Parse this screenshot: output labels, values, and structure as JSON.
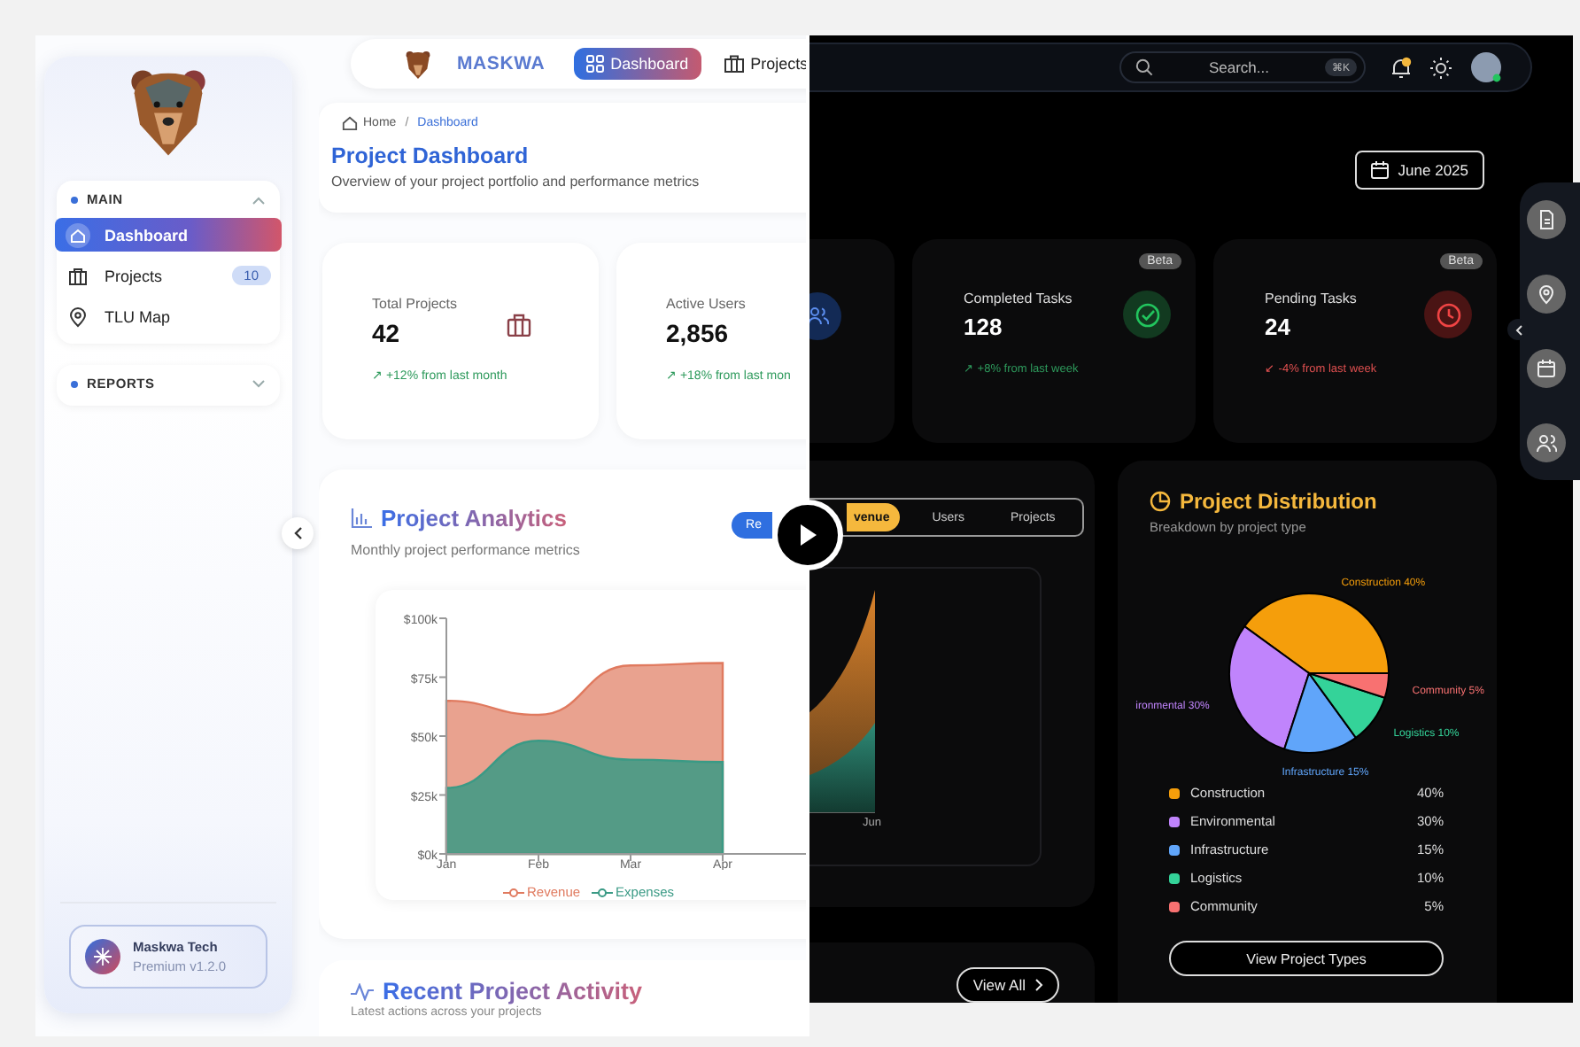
{
  "light": {
    "sidebar": {
      "sections": [
        {
          "title": "MAIN",
          "expanded": true,
          "items": [
            {
              "label": "Dashboard",
              "selected": true
            },
            {
              "label": "Projects",
              "selected": false,
              "badge": "10"
            },
            {
              "label": "TLU Map",
              "selected": false
            }
          ]
        },
        {
          "title": "REPORTS",
          "expanded": false
        }
      ],
      "footer": {
        "name": "Maskwa Tech",
        "plan": "Premium v1.2.0"
      }
    },
    "top_nav": {
      "brand": "MASKWA",
      "tabs": [
        {
          "label": "Dashboard",
          "selected": true
        },
        {
          "label": "Projects",
          "selected": false
        }
      ]
    },
    "breadcrumb": {
      "items": [
        "Home",
        "Dashboard"
      ],
      "separator": "/"
    },
    "header": {
      "title": "Project Dashboard",
      "subtitle": "Overview of your project portfolio and performance metrics"
    },
    "stats": [
      {
        "label": "Total Projects",
        "value": "42",
        "change": "↗ +12% from last month",
        "positive": true
      },
      {
        "label": "Active Users",
        "value": "2,856",
        "change": "↗ +18% from last mon",
        "positive": true
      }
    ],
    "analytics": {
      "title": "Project Analytics",
      "subtitle": "Monthly project performance metrics",
      "toggle_label": "Re",
      "chart_data": {
        "type": "area",
        "categories": [
          "Jan",
          "Feb",
          "Mar",
          "Apr"
        ],
        "series": [
          {
            "name": "Revenue",
            "color": "#e07a5f",
            "values": [
              65,
              59,
              80,
              81
            ]
          },
          {
            "name": "Expenses",
            "color": "#3a9a85",
            "values": [
              28,
              48,
              40,
              39
            ]
          }
        ],
        "stacked": false,
        "ylim": [
          0,
          100
        ],
        "yticks": [
          {
            "value": 0,
            "label": "$0k"
          },
          {
            "value": 25,
            "label": "$25k"
          },
          {
            "value": 50,
            "label": "$50k"
          },
          {
            "value": 75,
            "label": "$75k"
          },
          {
            "value": 100,
            "label": "$100k"
          }
        ]
      }
    },
    "activity": {
      "title": "Recent Project Activity",
      "subtitle": "Latest actions across your projects"
    }
  },
  "dark": {
    "search": {
      "placeholder": "Search...",
      "shortcut": "⌘K"
    },
    "date_button": "June 2025",
    "stats": [
      {
        "label": "Completed Tasks",
        "value": "128",
        "change": "↗ +8% from last week",
        "positive": true,
        "badge": "Beta"
      },
      {
        "label": "Pending Tasks",
        "value": "24",
        "change": "↙ -4% from last week",
        "positive": false,
        "badge": "Beta"
      }
    ],
    "analytics": {
      "toggle": [
        {
          "label": "venue",
          "selected": true
        },
        {
          "label": "Users",
          "selected": false
        },
        {
          "label": "Projects",
          "selected": false
        }
      ],
      "axis_label": "Jun"
    },
    "activity": {
      "button": "View All"
    },
    "distribution": {
      "title": "Project Distribution",
      "subtitle": "Breakdown by project type",
      "chart_data": {
        "type": "pie",
        "categories": [
          "Construction",
          "Environmental",
          "Infrastructure",
          "Logistics",
          "Community"
        ],
        "values": [
          40,
          30,
          15,
          10,
          5
        ],
        "value_labels": [
          "Construction 40%",
          "ironmental 30%",
          "Infrastructure 15%",
          "Logistics 10%",
          "Community 5%"
        ]
      },
      "legend": [
        {
          "value": "40%",
          "color": "#f59e0b"
        },
        {
          "value": "30%",
          "color": "#c084fc"
        },
        {
          "value": "15%",
          "color": "#60a5fa"
        },
        {
          "value": "10%",
          "color": "#34d399"
        },
        {
          "value": "5%",
          "color": "#f87171"
        }
      ],
      "button": "View Project Types"
    }
  }
}
